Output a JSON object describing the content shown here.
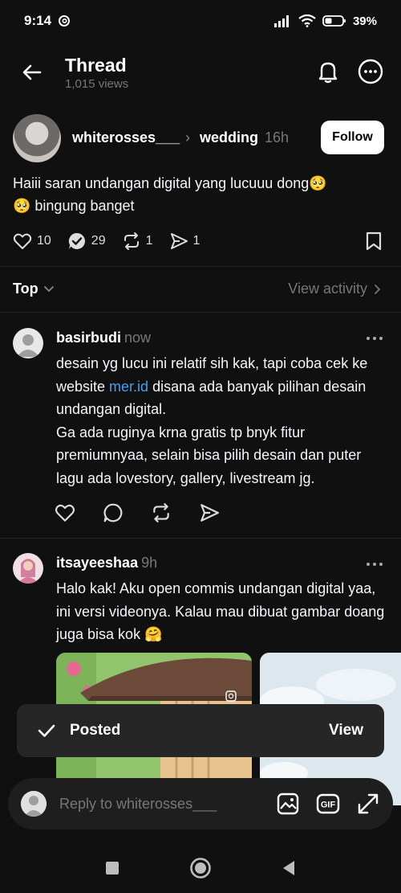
{
  "status_bar": {
    "time": "9:14",
    "battery": "39%"
  },
  "header": {
    "title": "Thread",
    "views": "1,015 views"
  },
  "post": {
    "author": "whiterosses___",
    "separator": "›",
    "topic": "wedding",
    "time": "16h",
    "follow_label": "Follow",
    "text_line1": "Haiii saran undangan digital yang lucuuu dong🥺",
    "text_line2": "🥺 bingung banget",
    "likes": "10",
    "replies": "29",
    "reposts": "1",
    "shares": "1"
  },
  "sort": {
    "label": "Top",
    "view_activity": "View activity"
  },
  "replies": [
    {
      "author": "basirbudi",
      "time": "now",
      "text_before_link": "desain yg lucu ini relatif sih kak, tapi coba cek ke website ",
      "link": "mer.id",
      "text_after_link": " disana ada banyak pilihan desain undangan digital.",
      "text_para2": "Ga ada ruginya krna gratis tp bnyk fitur premiumnyaa, selain bisa pilih desain dan puter lagu ada lovestory, gallery, livestream jg."
    },
    {
      "author": "itsayeeshaa",
      "time": "9h",
      "text": "Halo kak! Aku open commis undangan digital yaa, ini versi videonya. Kalau mau dibuat gambar doang juga bisa kok 🤗"
    }
  ],
  "toast": {
    "label": "Posted",
    "action": "View"
  },
  "reply_bar": {
    "placeholder": "Reply to whiterosses___"
  },
  "colors": {
    "background": "#101010",
    "link": "#4d9cf0",
    "muted": "#777777"
  }
}
